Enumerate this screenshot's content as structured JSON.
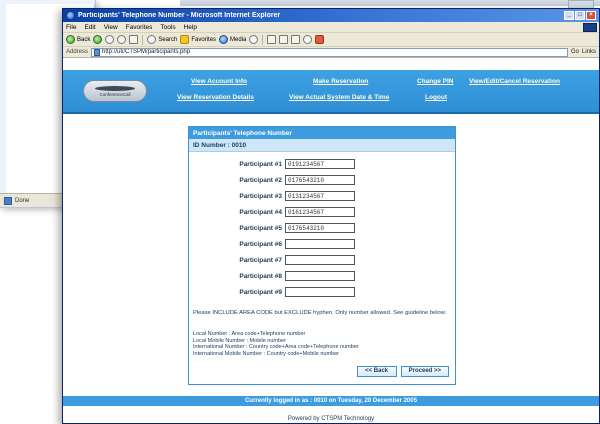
{
  "background_window": {
    "status_text": "Done"
  },
  "window": {
    "title": "Participants' Telephone Number - Microsoft Internet Explorer",
    "controls": [
      "_",
      "□",
      "×"
    ]
  },
  "menubar": {
    "items": [
      "File",
      "Edit",
      "View",
      "Favorites",
      "Tools",
      "Help"
    ]
  },
  "toolbar": {
    "back_label": "Back",
    "search_label": "Search",
    "favorites_label": "Favorites",
    "media_label": "Media"
  },
  "addressbar": {
    "label": "Address",
    "url": "http://uti/CTSPM/participants.php",
    "go_label": "Go",
    "links_label": "Links"
  },
  "site": {
    "logo_text": "ConferenceCall",
    "nav": {
      "new_account_info": "View Account Info",
      "make_reservation": "Make Reservation",
      "change_pin": "Change PIN",
      "view_edit_cancel": "View/Edit/Cancel Reservation",
      "view_reservation_details": "View Reservation Details",
      "view_actual_system_date": "View Actual System Date & Time",
      "logout": "Logout"
    }
  },
  "form": {
    "title": "Participants' Telephone Number",
    "id_number": "ID Number : 0010",
    "participants": [
      {
        "label": "Participant #1",
        "value": "0191234567"
      },
      {
        "label": "Participant #2",
        "value": "0176543210"
      },
      {
        "label": "Participant #3",
        "value": "0131234567"
      },
      {
        "label": "Participant #4",
        "value": "0161234567"
      },
      {
        "label": "Participant #5",
        "value": "0176543210"
      },
      {
        "label": "Participant #6",
        "value": ""
      },
      {
        "label": "Participant #7",
        "value": ""
      },
      {
        "label": "Participant #8",
        "value": ""
      },
      {
        "label": "Participant #9",
        "value": ""
      }
    ],
    "note": "Please INCLUDE AREA CODE but EXCLUDE hyphen. Only number allowed. See guideline below.",
    "formats": [
      "Local Number : Area code+Telephone number",
      "Local Mobile Number : Mobile number",
      "International Number : Country code+Area code+Telephone number",
      "International Mobile Number : Country code+Mobile number"
    ],
    "back_button": "<< Back",
    "proceed_button": "Proceed >>"
  },
  "footer": {
    "login_status": "Currently logged in as : 0010 on Tuesday, 20 December 2005",
    "powered_by": "Powered by CTSPM Technology"
  }
}
